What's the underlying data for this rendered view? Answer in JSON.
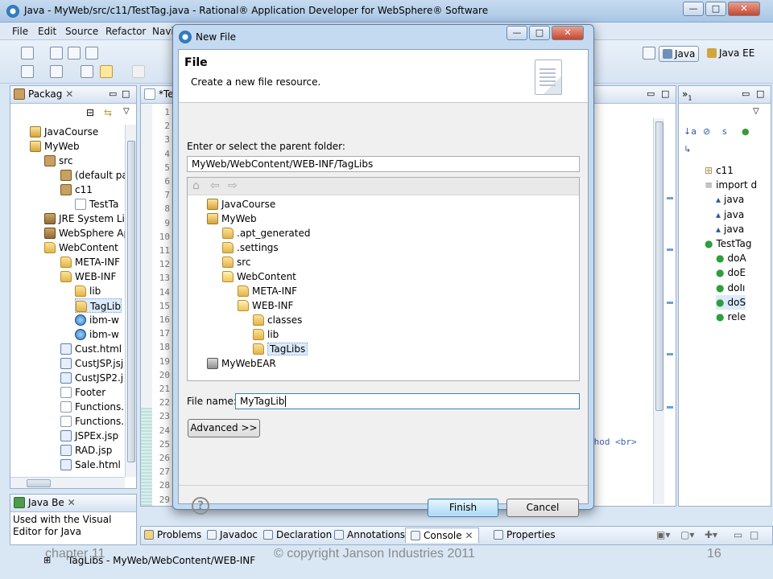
{
  "window": {
    "title": "Java - MyWeb/src/c11/TestTag.java - Rational® Application Developer for WebSphere® Software",
    "controls": [
      "—",
      "□",
      "✕"
    ]
  },
  "menu": [
    "File",
    "Edit",
    "Source",
    "Refactor",
    "Navi"
  ],
  "perspectives": {
    "java": "Java",
    "javaee": "Java EE"
  },
  "package_explorer": {
    "tab": "Packag",
    "items": [
      {
        "label": "JavaCourse",
        "icon": "project-icon"
      },
      {
        "label": "MyWeb",
        "icon": "project-icon"
      },
      {
        "label": "src",
        "icon": "source-folder-icon"
      },
      {
        "label": "(default pa",
        "icon": "package-icon"
      },
      {
        "label": "c11",
        "icon": "package-icon"
      },
      {
        "label": "TestTa",
        "icon": "java-file-icon"
      },
      {
        "label": "JRE System Lil",
        "icon": "library-icon"
      },
      {
        "label": "WebSphere Ap",
        "icon": "library-icon"
      },
      {
        "label": "WebContent",
        "icon": "folder-icon"
      },
      {
        "label": "META-INF",
        "icon": "folder-icon"
      },
      {
        "label": "WEB-INF",
        "icon": "folder-icon"
      },
      {
        "label": "lib",
        "icon": "folder-icon"
      },
      {
        "label": "TagLib",
        "icon": "folder-icon"
      },
      {
        "label": "ibm-w",
        "icon": "web-file-icon"
      },
      {
        "label": "ibm-w",
        "icon": "web-file-icon"
      },
      {
        "label": "Cust.html",
        "icon": "html-file-icon"
      },
      {
        "label": "CustJSP.jsj",
        "icon": "jsp-file-icon"
      },
      {
        "label": "CustJSP2.j",
        "icon": "jsp-file-icon"
      },
      {
        "label": "Footer",
        "icon": "file-icon"
      },
      {
        "label": "Functions.",
        "icon": "file-icon"
      },
      {
        "label": "Functions.",
        "icon": "file-icon"
      },
      {
        "label": "JSPEx.jsp",
        "icon": "jsp-file-icon"
      },
      {
        "label": "RAD.jsp",
        "icon": "jsp-file-icon"
      },
      {
        "label": "Sale.html",
        "icon": "html-file-icon"
      }
    ]
  },
  "java_beans": {
    "tab": "Java Be",
    "text": "Used with the Visual Editor for Java"
  },
  "editor": {
    "tab": "*Te",
    "line_numbers": [
      "1",
      "2",
      "3",
      "4",
      "5",
      "6",
      "7",
      "8",
      "9",
      "10",
      "11",
      "12",
      "13",
      "14",
      "15",
      "16",
      "17",
      "18",
      "19",
      "20",
      "21",
      "22",
      "23",
      "24",
      "25",
      "26",
      "27",
      "28",
      "29"
    ],
    "code_snippet": "thod <br>"
  },
  "outline": {
    "items": [
      "c11",
      "import d",
      "java",
      "java",
      "java",
      "TestTag",
      "doA",
      "doE",
      "doIı",
      "doS",
      "rele"
    ]
  },
  "bottom_tabs": [
    "Problems",
    "Javadoc",
    "Declaration",
    "Annotations",
    "Console",
    "Properties"
  ],
  "status": {
    "path": "TagLibs - MyWeb/WebContent/WEB-INF"
  },
  "dialog": {
    "title": "New File",
    "heading": "File",
    "description": "Create a new file resource.",
    "parent_label": "Enter or select the parent folder:",
    "parent_value": "MyWeb/WebContent/WEB-INF/TagLibs",
    "tree": [
      {
        "label": "JavaCourse",
        "depth": 0,
        "icon": "project-icon"
      },
      {
        "label": "MyWeb",
        "depth": 0,
        "icon": "project-icon"
      },
      {
        "label": ".apt_generated",
        "depth": 1,
        "icon": "folder-icon"
      },
      {
        "label": ".settings",
        "depth": 1,
        "icon": "folder-icon"
      },
      {
        "label": "src",
        "depth": 1,
        "icon": "folder-icon"
      },
      {
        "label": "WebContent",
        "depth": 1,
        "icon": "open-folder-icon"
      },
      {
        "label": "META-INF",
        "depth": 2,
        "icon": "folder-icon"
      },
      {
        "label": "WEB-INF",
        "depth": 2,
        "icon": "open-folder-icon"
      },
      {
        "label": "classes",
        "depth": 3,
        "icon": "folder-icon"
      },
      {
        "label": "lib",
        "depth": 3,
        "icon": "folder-icon"
      },
      {
        "label": "TagLibs",
        "depth": 3,
        "icon": "folder-icon",
        "selected": true
      },
      {
        "label": "MyWebEAR",
        "depth": 0,
        "icon": "ear-project-icon"
      }
    ],
    "filename_label": "File name:",
    "filename_value": "MyTagLib",
    "advanced_label": "Advanced >>",
    "finish_label": "Finish",
    "cancel_label": "Cancel",
    "help_glyph": "?"
  },
  "slide_footer": {
    "chapter": "chapter 11",
    "copyright": "© copyright Janson Industries 2011",
    "page": "16"
  },
  "colors": {
    "accent": "#3c7fb1",
    "titlebar": "#a9c6e6",
    "selection": "#dcebfc"
  }
}
